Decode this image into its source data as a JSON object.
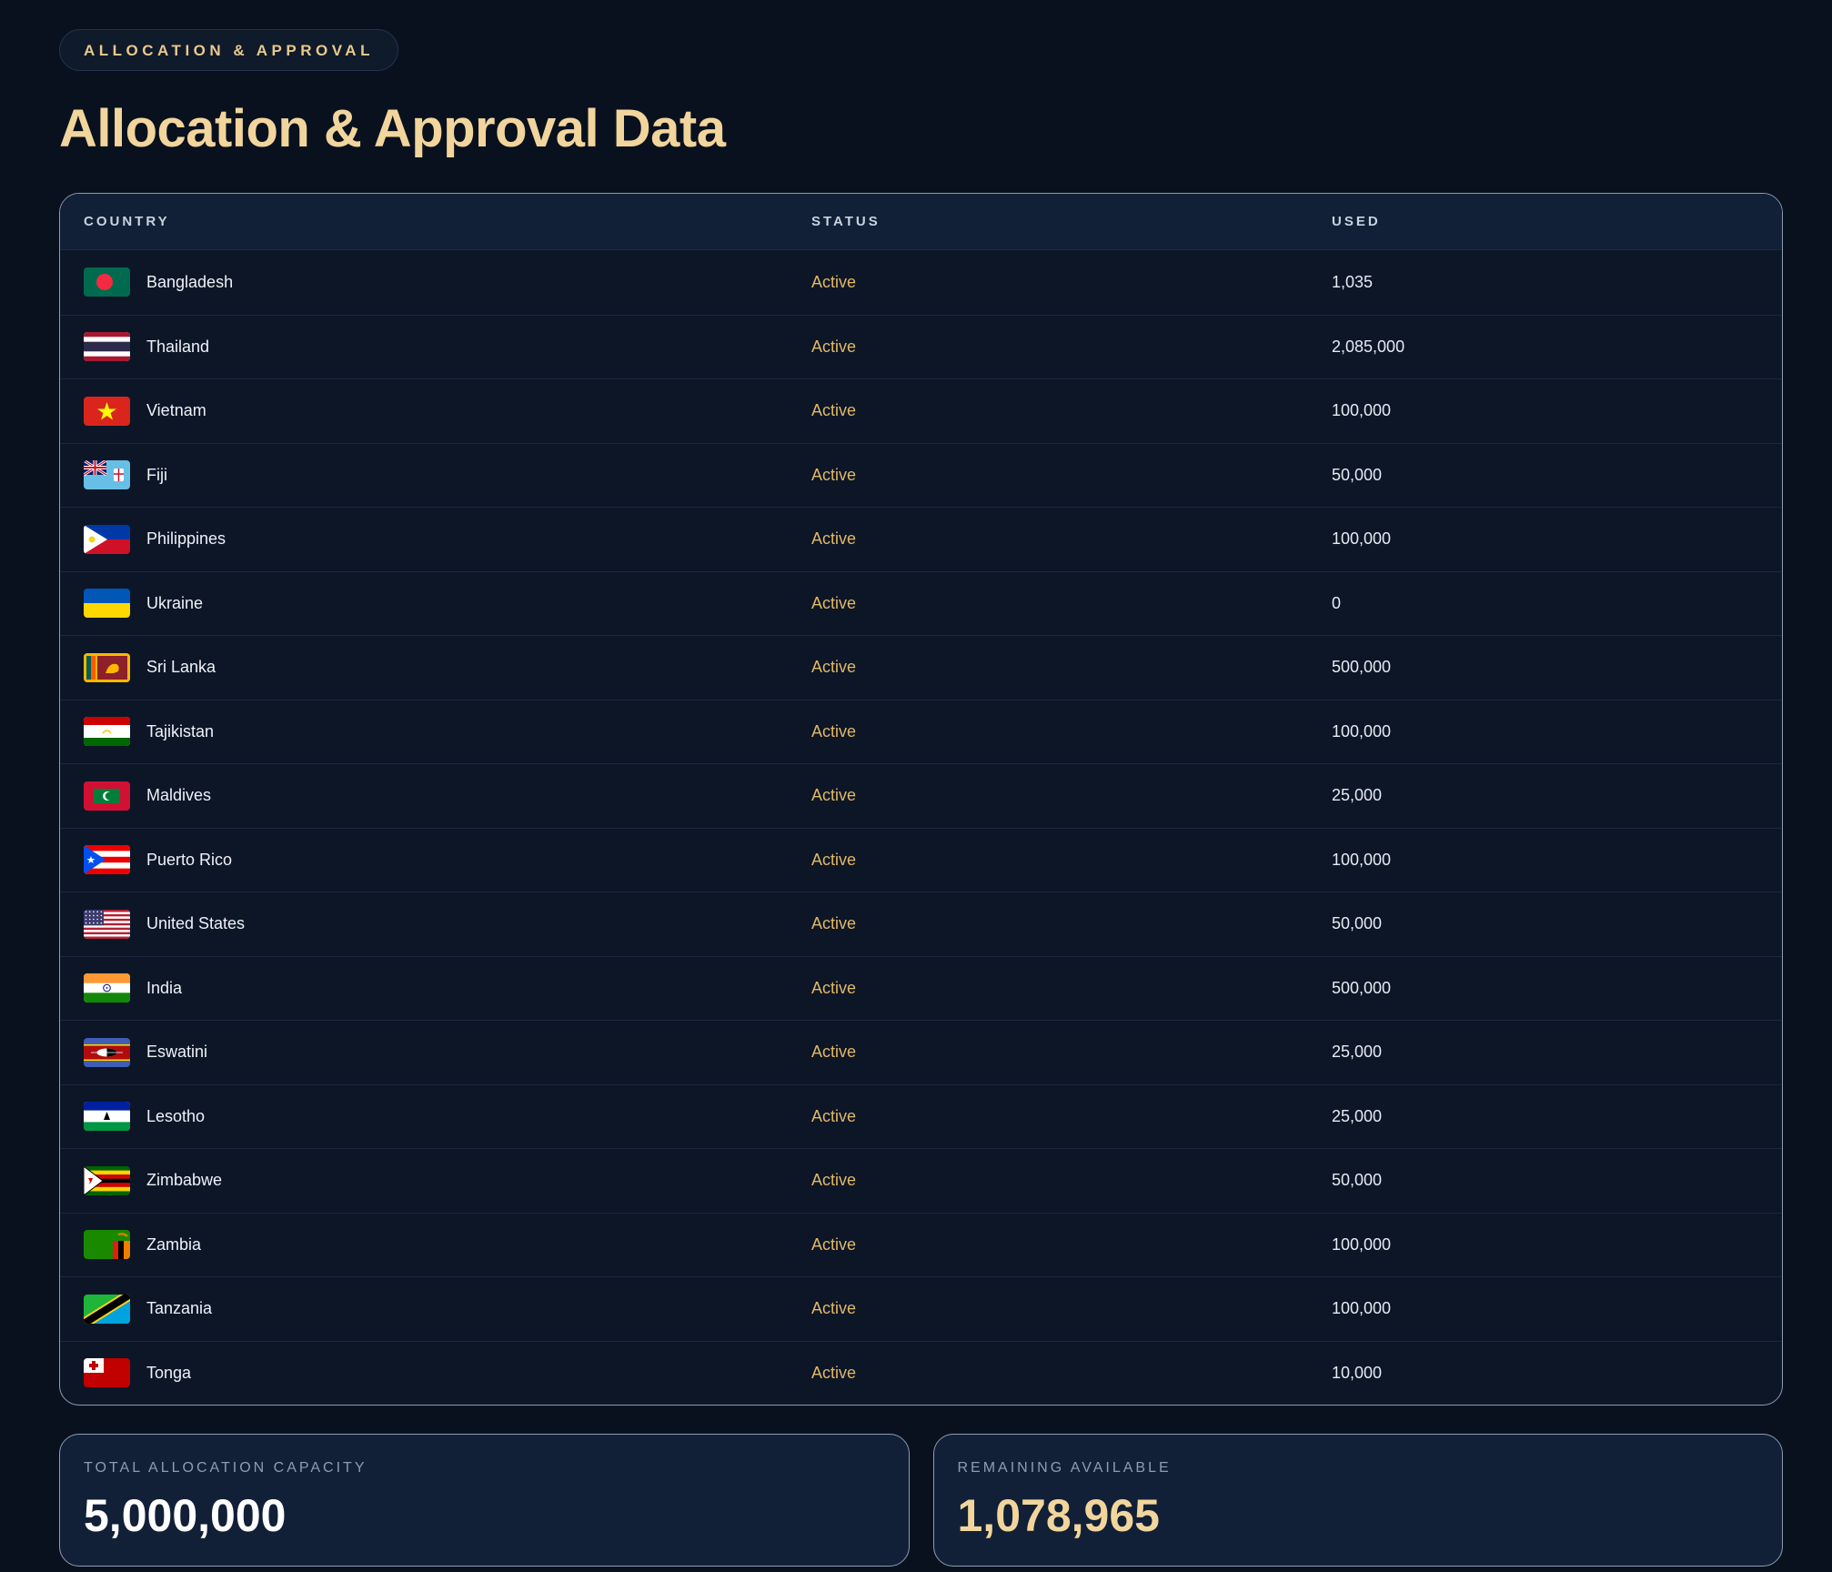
{
  "badge": "ALLOCATION & APPROVAL",
  "title": "Allocation & Approval Data",
  "table": {
    "headers": {
      "country": "COUNTRY",
      "status": "STATUS",
      "used": "USED"
    },
    "rows": [
      {
        "flag": "bangladesh-flag-icon",
        "country": "Bangladesh",
        "status": "Active",
        "used": "1,035"
      },
      {
        "flag": "thailand-flag-icon",
        "country": "Thailand",
        "status": "Active",
        "used": "2,085,000"
      },
      {
        "flag": "vietnam-flag-icon",
        "country": "Vietnam",
        "status": "Active",
        "used": "100,000"
      },
      {
        "flag": "fiji-flag-icon",
        "country": "Fiji",
        "status": "Active",
        "used": "50,000"
      },
      {
        "flag": "philippines-flag-icon",
        "country": "Philippines",
        "status": "Active",
        "used": "100,000"
      },
      {
        "flag": "ukraine-flag-icon",
        "country": "Ukraine",
        "status": "Active",
        "used": "0"
      },
      {
        "flag": "sri-lanka-flag-icon",
        "country": "Sri Lanka",
        "status": "Active",
        "used": "500,000"
      },
      {
        "flag": "tajikistan-flag-icon",
        "country": "Tajikistan",
        "status": "Active",
        "used": "100,000"
      },
      {
        "flag": "maldives-flag-icon",
        "country": "Maldives",
        "status": "Active",
        "used": "25,000"
      },
      {
        "flag": "puerto-rico-flag-icon",
        "country": "Puerto Rico",
        "status": "Active",
        "used": "100,000"
      },
      {
        "flag": "united-states-flag-icon",
        "country": "United States",
        "status": "Active",
        "used": "50,000"
      },
      {
        "flag": "india-flag-icon",
        "country": "India",
        "status": "Active",
        "used": "500,000"
      },
      {
        "flag": "eswatini-flag-icon",
        "country": "Eswatini",
        "status": "Active",
        "used": "25,000"
      },
      {
        "flag": "lesotho-flag-icon",
        "country": "Lesotho",
        "status": "Active",
        "used": "25,000"
      },
      {
        "flag": "zimbabwe-flag-icon",
        "country": "Zimbabwe",
        "status": "Active",
        "used": "50,000"
      },
      {
        "flag": "zambia-flag-icon",
        "country": "Zambia",
        "status": "Active",
        "used": "100,000"
      },
      {
        "flag": "tanzania-flag-icon",
        "country": "Tanzania",
        "status": "Active",
        "used": "100,000"
      },
      {
        "flag": "tonga-flag-icon",
        "country": "Tonga",
        "status": "Active",
        "used": "10,000"
      }
    ]
  },
  "summary": {
    "total_label": "TOTAL ALLOCATION CAPACITY",
    "total_value": "5,000,000",
    "remaining_label": "REMAINING AVAILABLE",
    "remaining_value": "1,078,965"
  },
  "colors": {
    "background": "#09111f",
    "accent_gold": "#f1d59c",
    "status_active": "#e2b866"
  }
}
